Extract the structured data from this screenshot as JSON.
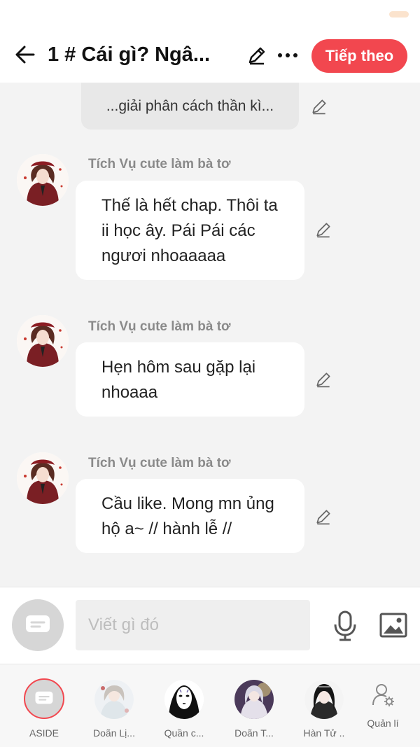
{
  "header": {
    "title": "1 # Cái gì? Ngâ...",
    "next_label": "Tiếp theo"
  },
  "narration": {
    "text": "...giải phân cách thần kì..."
  },
  "messages": [
    {
      "sender": "Tích Vụ cute làm bà tơ",
      "text": "Thế là hết chap. Thôi ta ii học ây. Pái Pái các ngươi nhoaaaaa"
    },
    {
      "sender": "Tích Vụ cute làm bà tơ",
      "text": "Hẹn hôm sau gặp lại nhoaaa"
    },
    {
      "sender": "Tích Vụ cute làm bà tơ",
      "text": "Cầu like. Mong mn ủng hộ a~ // hành lễ //"
    }
  ],
  "composer": {
    "placeholder": "Viết gì đó"
  },
  "characters": [
    {
      "label": "ASIDE"
    },
    {
      "label": "Doãn Lị..."
    },
    {
      "label": "Quần c..."
    },
    {
      "label": "Doãn T..."
    },
    {
      "label": "Hàn Tử .."
    },
    {
      "label": "Quản lí"
    }
  ],
  "colors": {
    "accent": "#f2474f",
    "background": "#f3f3f3"
  }
}
